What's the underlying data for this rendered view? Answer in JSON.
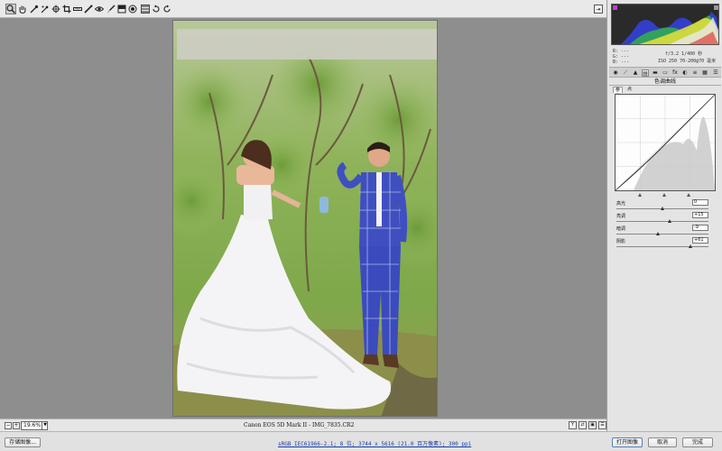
{
  "toolbar": {
    "tools": [
      "zoom-tool",
      "hand-tool",
      "white-balance-tool",
      "color-sampler-tool",
      "targeted-adjustment-tool",
      "crop-tool",
      "straighten-tool",
      "spot-removal-tool",
      "red-eye-tool",
      "adjustment-brush-tool",
      "graduated-filter-tool",
      "radial-filter-tool",
      "preferences-tool",
      "rotate-ccw-tool",
      "rotate-cw-tool"
    ]
  },
  "status": {
    "zoom": "19.6%",
    "filename": "Canon EOS 5D Mark II -  IMG_7835.CR2"
  },
  "bottom": {
    "save_label": "存储图像...",
    "workflow": "sRGB IEC61966-2.1; 8 位; 3744 x 5616 (21.0 百万像素); 300 ppi",
    "open_label": "打开图像",
    "cancel_label": "取消",
    "done_label": "完成"
  },
  "info": {
    "r_label": "R:",
    "g_label": "G:",
    "b_label": "B:",
    "r_value": "---",
    "g_value": "---",
    "b_value": "---",
    "exposure": "f/3.2   1/400 秒",
    "iso": "ISO 250   70-200@70 毫米"
  },
  "panel": {
    "section_title": "色调曲线",
    "subtab_parametric": "参数",
    "subtab_point": "点"
  },
  "sliders": [
    {
      "label": "高光",
      "value": "0",
      "position": 0.5
    },
    {
      "label": "亮调",
      "value": "+15",
      "position": 0.58
    },
    {
      "label": "暗调",
      "value": "-9",
      "position": 0.45
    },
    {
      "label": "阴影",
      "value": "+61",
      "position": 0.8
    }
  ]
}
